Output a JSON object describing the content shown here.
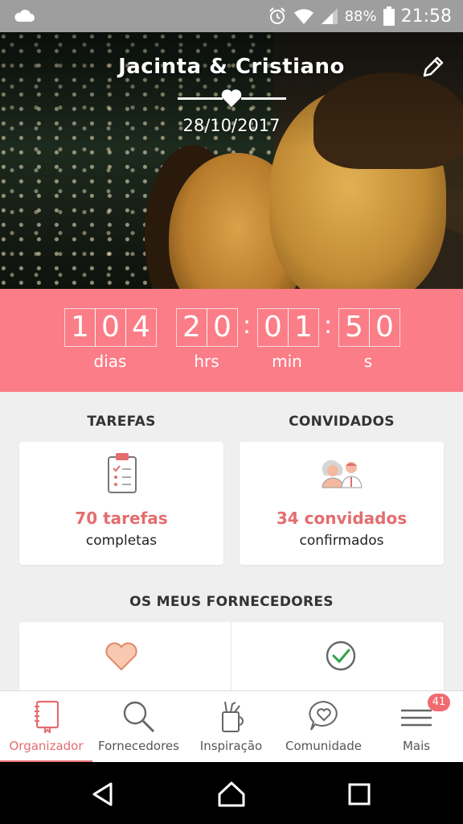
{
  "status_bar": {
    "battery": "88%",
    "time": "21:58"
  },
  "hero": {
    "couple_names": "Jacinta & Cristiano",
    "wedding_date": "28/10/2017"
  },
  "countdown": {
    "days": [
      "1",
      "0",
      "4"
    ],
    "hours": [
      "2",
      "0"
    ],
    "minutes": [
      "0",
      "1"
    ],
    "seconds": [
      "5",
      "0"
    ],
    "labels": {
      "days": "dias",
      "hours": "hrs",
      "minutes": "min",
      "seconds": "s"
    }
  },
  "tasks": {
    "title": "TAREFAS",
    "value": "70 tarefas",
    "sub": "completas"
  },
  "guests": {
    "title": "CONVIDADOS",
    "value": "34 convidados",
    "sub": "confirmados"
  },
  "vendors": {
    "title": "OS MEUS FORNECEDORES"
  },
  "bottom_nav": {
    "items": [
      {
        "label": "Organizador"
      },
      {
        "label": "Fornecedores"
      },
      {
        "label": "Inspiração"
      },
      {
        "label": "Comunidade"
      },
      {
        "label": "Mais"
      }
    ],
    "badge": "41"
  },
  "colors": {
    "accent": "#fb7d87",
    "accent_text": "#e36d6f"
  }
}
